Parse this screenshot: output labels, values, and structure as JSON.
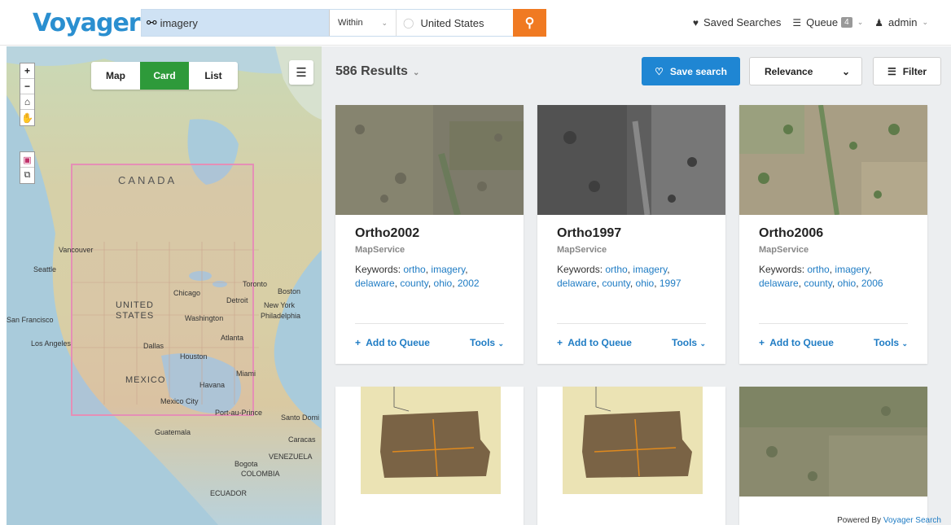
{
  "header": {
    "logo": "Voyager",
    "search": {
      "value": "imagery"
    },
    "within": "Within",
    "place": "United States",
    "saved_searches": "Saved Searches",
    "queue": "Queue",
    "queue_count": "4",
    "user": "admin"
  },
  "map": {
    "views": [
      "Map",
      "Card",
      "List"
    ],
    "active_view": "Card",
    "labels": {
      "canada": "CANADA",
      "united": "UNITED",
      "states": "STATES",
      "mexico": "MEXICO",
      "vancouver": "Vancouver",
      "seattle": "Seattle",
      "sanfrancisco": "San Francisco",
      "losangeles": "Los Angeles",
      "chicago": "Chicago",
      "toronto": "Toronto",
      "detroit": "Detroit",
      "boston": "Boston",
      "newyork": "New York",
      "philadelphia": "Philadelphia",
      "washington": "Washington",
      "atlanta": "Atlanta",
      "dallas": "Dallas",
      "houston": "Houston",
      "miami": "Miami",
      "havana": "Havana",
      "mexicocity": "Mexico City",
      "portauprince": "Port-au-Prince",
      "santodomingo": "Santo Domi",
      "guatemala": "Guatemala",
      "caracas": "Caracas",
      "venezuela": "VENEZUELA",
      "bogota": "Bogota",
      "colombia": "COLOMBIA",
      "ecuador": "ECUADOR"
    }
  },
  "results": {
    "count": "586 Results",
    "save_search": "Save search",
    "sort": "Relevance",
    "filter": "Filter",
    "keywords_label": "Keywords:",
    "add_to_queue": "Add to Queue",
    "tools": "Tools",
    "cards": [
      {
        "title": "Ortho2002",
        "format": "MapService",
        "keywords": [
          "ortho",
          "imagery",
          "delaware",
          "county",
          "ohio",
          "2002"
        ]
      },
      {
        "title": "Ortho1997",
        "format": "MapService",
        "keywords": [
          "ortho",
          "imagery",
          "delaware",
          "county",
          "ohio",
          "1997"
        ]
      },
      {
        "title": "Ortho2006",
        "format": "MapService",
        "keywords": [
          "ortho",
          "imagery",
          "delaware",
          "county",
          "ohio",
          "2006"
        ]
      }
    ]
  },
  "footer": {
    "powered_by": "Powered By",
    "powered_link": "Voyager Search"
  }
}
